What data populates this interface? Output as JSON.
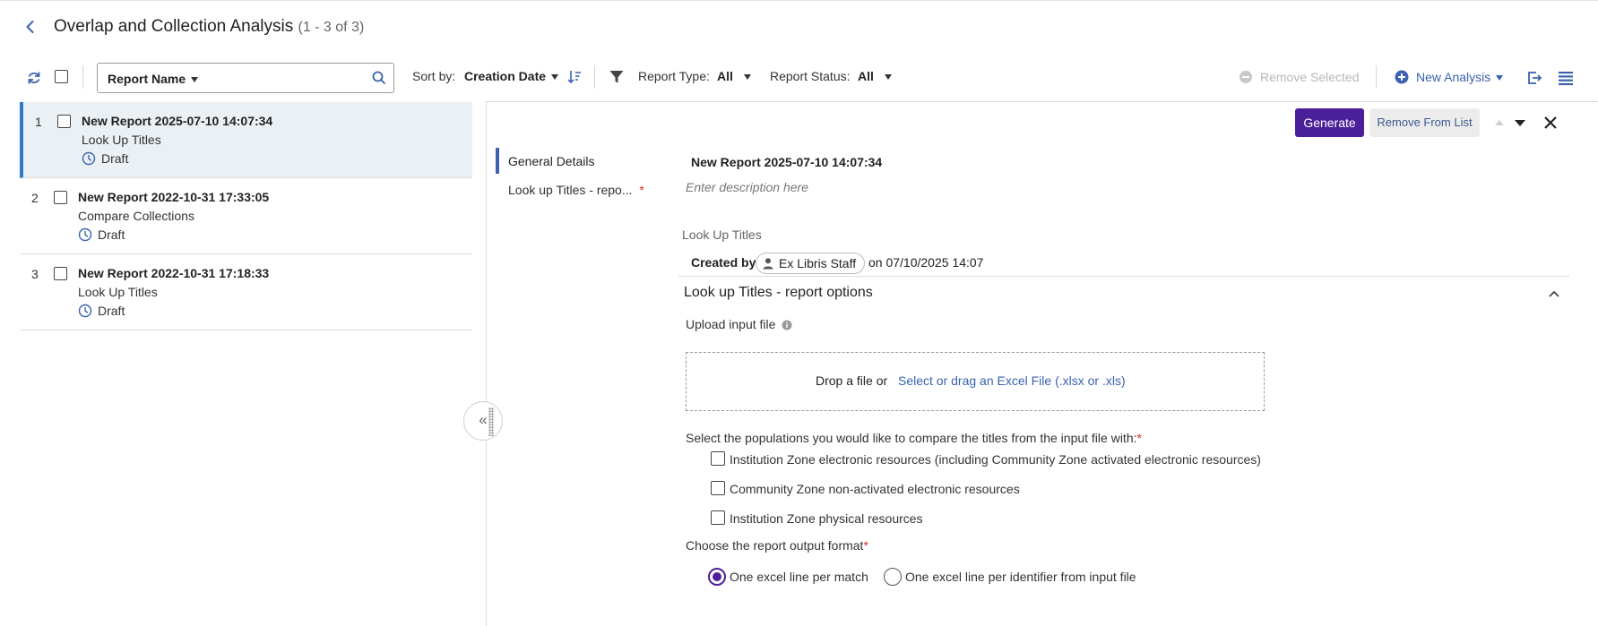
{
  "header": {
    "title": "Overlap and Collection Analysis",
    "count": "(1 - 3 of 3)"
  },
  "toolbar": {
    "search_field_label": "Report Name",
    "search_value": "",
    "sort_label": "Sort by:",
    "sort_value": "Creation Date",
    "report_type_label": "Report Type:",
    "report_type_value": "All",
    "report_status_label": "Report Status:",
    "report_status_value": "All",
    "remove_selected": "Remove Selected",
    "new_analysis": "New Analysis"
  },
  "list": {
    "items": [
      {
        "num": "1",
        "title": "New Report 2025-07-10 14:07:34",
        "type": "Look Up Titles",
        "status": "Draft"
      },
      {
        "num": "2",
        "title": "New Report 2022-10-31 17:33:05",
        "type": "Compare Collections",
        "status": "Draft"
      },
      {
        "num": "3",
        "title": "New Report 2022-10-31 17:18:33",
        "type": "Look Up Titles",
        "status": "Draft"
      }
    ]
  },
  "detail": {
    "generate": "Generate",
    "remove_from_list": "Remove From List",
    "nav": {
      "general": "General Details",
      "options": "Look up Titles - repo...",
      "options_required": "*"
    },
    "name": "New Report 2025-07-10 14:07:34",
    "description_placeholder": "Enter description here",
    "type": "Look Up Titles",
    "created_by_label": "Created by",
    "creator": "Ex Libris Staff",
    "created_on": "on 07/10/2025 14:07",
    "section_title": "Look up Titles - report options",
    "upload_label": "Upload input file",
    "drop_text": "Drop a file or",
    "drop_link": "Select or drag an Excel File (.xlsx or .xls)",
    "populations_label": "Select the populations you would like to compare the titles from the input file with:",
    "required_mark": "*",
    "populations": [
      "Institution Zone electronic resources (including Community Zone activated electronic resources)",
      "Community Zone non-activated electronic resources",
      "Institution Zone physical resources"
    ],
    "format_label": "Choose the report output format",
    "formats": [
      "One excel line per match",
      "One excel line per identifier from input file"
    ],
    "selected_format": "One excel line per match"
  },
  "colors": {
    "primary": "#4c1f9a",
    "link": "#3a62b1",
    "active_bar": "#2e7cc4",
    "required": "#d32f2f"
  }
}
